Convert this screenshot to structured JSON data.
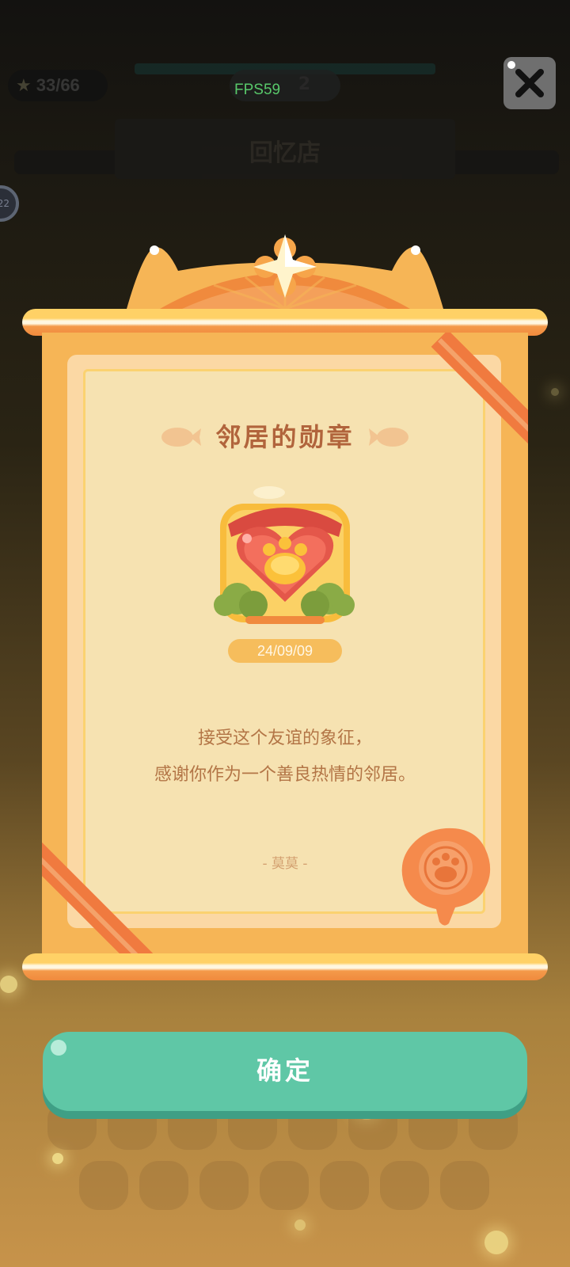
{
  "hud": {
    "star_count": "33/66",
    "middle_count": "2",
    "fps": "FPS59",
    "shop_sign": "回忆店",
    "side_badge": "22"
  },
  "popup": {
    "title": "邻居的勋章",
    "date": "24/09/09",
    "message_line1": "接受这个友谊的象征，",
    "message_line2": "感谢你作为一个善良热情的邻居。",
    "signature": "- 莫莫 -",
    "confirm_label": "确定"
  },
  "icons": {
    "close": "close-icon",
    "medal": "heart-paw-medal-icon",
    "seal": "paw-wax-seal-icon",
    "fish": "fish-ornament-icon",
    "star": "star-icon"
  },
  "colors": {
    "accent_button": "#5fc7a6",
    "scroll_frame": "#f6b556",
    "paper": "#f6e2b1",
    "title_text": "#b1643c",
    "ribbon": "#f07a3f"
  }
}
